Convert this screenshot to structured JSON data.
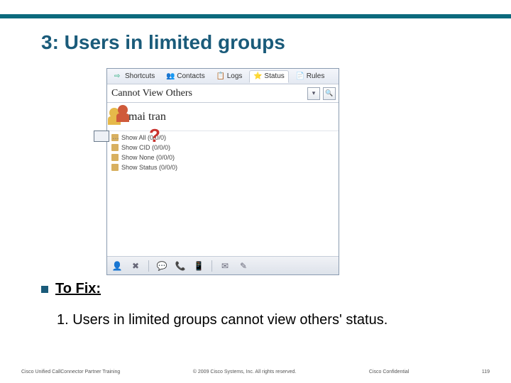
{
  "slide": {
    "title": "3: Users in limited groups",
    "to_fix_label": "To Fix:",
    "body_line": "1. Users in limited groups cannot view others' status."
  },
  "app": {
    "tabs": {
      "shortcuts": "Shortcuts",
      "contacts": "Contacts",
      "logs": "Logs",
      "status": "Status",
      "rules": "Rules"
    },
    "search_value": "Cannot View Others",
    "user_row": "mai tran",
    "tree": {
      "r0": "Show All  (0/0/0)",
      "r1": "Show CID  (0/0/0)",
      "r2": "Show None  (0/0/0)",
      "r3": "Show Status  (0/0/0)"
    }
  },
  "footer": {
    "left": "Cisco Unified CallConnector Partner Training",
    "mid": "© 2009 Cisco Systems, Inc. All rights reserved.",
    "right": "Cisco Confidential",
    "page": "119"
  }
}
